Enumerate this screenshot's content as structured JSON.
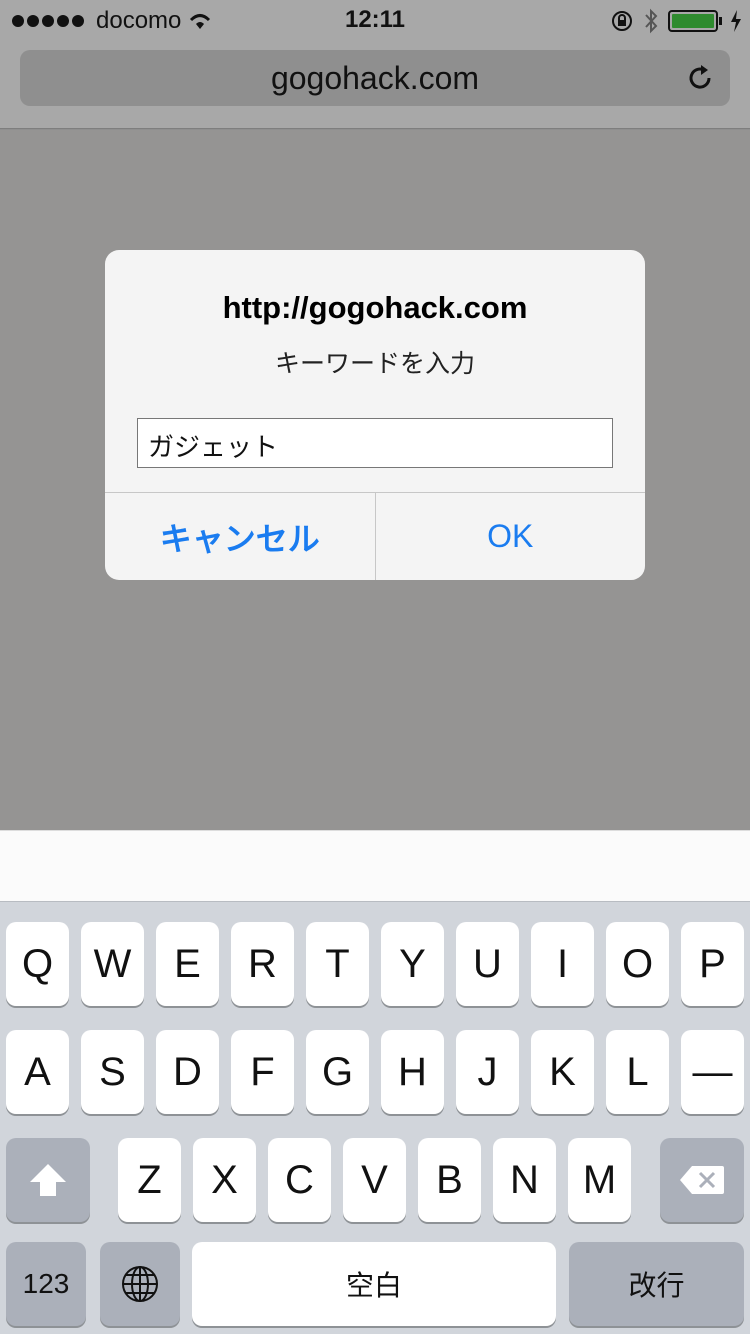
{
  "status_bar": {
    "carrier": "docomo",
    "time": "12:11"
  },
  "browser": {
    "url": "gogohack.com"
  },
  "dialog": {
    "title": "http://gogohack.com",
    "message": "キーワードを入力",
    "input_value": "ガジェット",
    "cancel_label": "キャンセル",
    "ok_label": "OK"
  },
  "keyboard": {
    "row1": [
      "Q",
      "W",
      "E",
      "R",
      "T",
      "Y",
      "U",
      "I",
      "O",
      "P"
    ],
    "row2": [
      "A",
      "S",
      "D",
      "F",
      "G",
      "H",
      "J",
      "K",
      "L",
      "—"
    ],
    "row3": [
      "Z",
      "X",
      "C",
      "V",
      "B",
      "N",
      "M"
    ],
    "numbers_label": "123",
    "space_label": "空白",
    "return_label": "改行"
  },
  "colors": {
    "accent": "#1a7cf0",
    "battery": "#2e8b2e"
  }
}
